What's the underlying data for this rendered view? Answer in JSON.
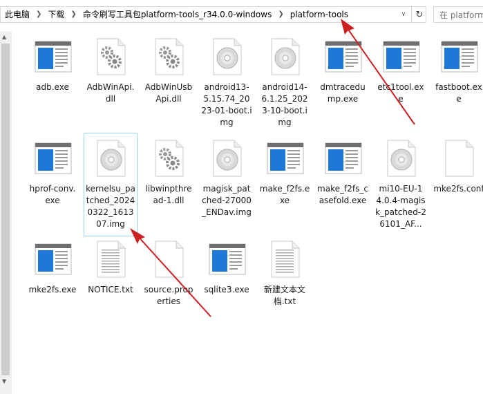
{
  "breadcrumb": {
    "items": [
      "此电脑",
      "下载",
      "命令刷写工具包platform-tools_r34.0.0-windows",
      "platform-tools"
    ]
  },
  "search": {
    "placeholder": "在 platform"
  },
  "files": [
    {
      "name": "adb.exe",
      "icon": "exe-window-icon"
    },
    {
      "name": "AdbWinApi.dll",
      "icon": "dll-gear-icon"
    },
    {
      "name": "AdbWinUsbApi.dll",
      "icon": "dll-gear-icon"
    },
    {
      "name": "android13-5.15.74_2023-01-boot.img",
      "icon": "disc-image-icon"
    },
    {
      "name": "android14-6.1.25_2023-10-boot.img",
      "icon": "disc-image-icon"
    },
    {
      "name": "dmtracedump.exe",
      "icon": "exe-window-icon"
    },
    {
      "name": "etc1tool.exe",
      "icon": "exe-window-icon"
    },
    {
      "name": "fastboot.exe",
      "icon": "exe-window-icon"
    },
    {
      "name": "hprof-conv.exe",
      "icon": "exe-window-icon"
    },
    {
      "name": "kernelsu_patched_20240322_161307.img",
      "icon": "disc-image-icon",
      "selected": true
    },
    {
      "name": "libwinpthread-1.dll",
      "icon": "dll-gear-icon"
    },
    {
      "name": "magisk_patched-27000_ENDav.img",
      "icon": "disc-image-icon"
    },
    {
      "name": "make_f2fs.exe",
      "icon": "exe-window-icon"
    },
    {
      "name": "make_f2fs_casefold.exe",
      "icon": "exe-window-icon"
    },
    {
      "name": "mi10-EU-14.0.4-magisk_patched-26101_AF...",
      "icon": "disc-image-icon"
    },
    {
      "name": "mke2fs.conf",
      "icon": "blank-file-icon"
    },
    {
      "name": "mke2fs.exe",
      "icon": "exe-window-icon"
    },
    {
      "name": "NOTICE.txt",
      "icon": "text-file-icon"
    },
    {
      "name": "source.properties",
      "icon": "blank-file-icon"
    },
    {
      "name": "sqlite3.exe",
      "icon": "exe-window-icon"
    },
    {
      "name": "新建文本文档.txt",
      "icon": "text-file-icon"
    }
  ],
  "colors": {
    "arrow": "#cc1f1f",
    "selection_border": "#99d1ff",
    "exe_blue": "#1e78d6"
  }
}
